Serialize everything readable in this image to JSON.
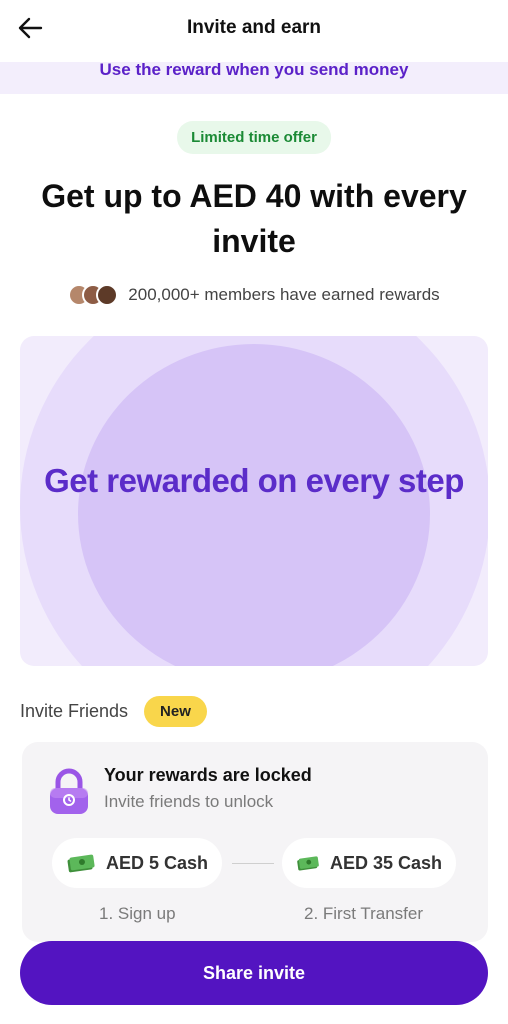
{
  "header": {
    "title": "Invite and earn",
    "back_icon": "arrow-left-icon"
  },
  "banner": {
    "text": "Use the reward when you send money"
  },
  "offer_badge": "Limited time offer",
  "headline": "Get up to AED 40 with every invite",
  "members": {
    "text": "200,000+ members have earned rewards"
  },
  "hero": {
    "text": "Get rewarded on every step"
  },
  "invite_section": {
    "title": "Invite Friends",
    "badge": "New"
  },
  "rewards_card": {
    "title": "Your rewards are locked",
    "subtitle": "Invite friends to unlock",
    "rewards": [
      {
        "amount": "AED 5 Cash",
        "step": "1. Sign up"
      },
      {
        "amount": "AED 35 Cash",
        "step": "2. First Transfer"
      }
    ]
  },
  "cta": {
    "label": "Share invite"
  },
  "colors": {
    "brand": "#5314c1",
    "offer_green": "#1b8a35",
    "new_badge": "#f9d64b"
  }
}
